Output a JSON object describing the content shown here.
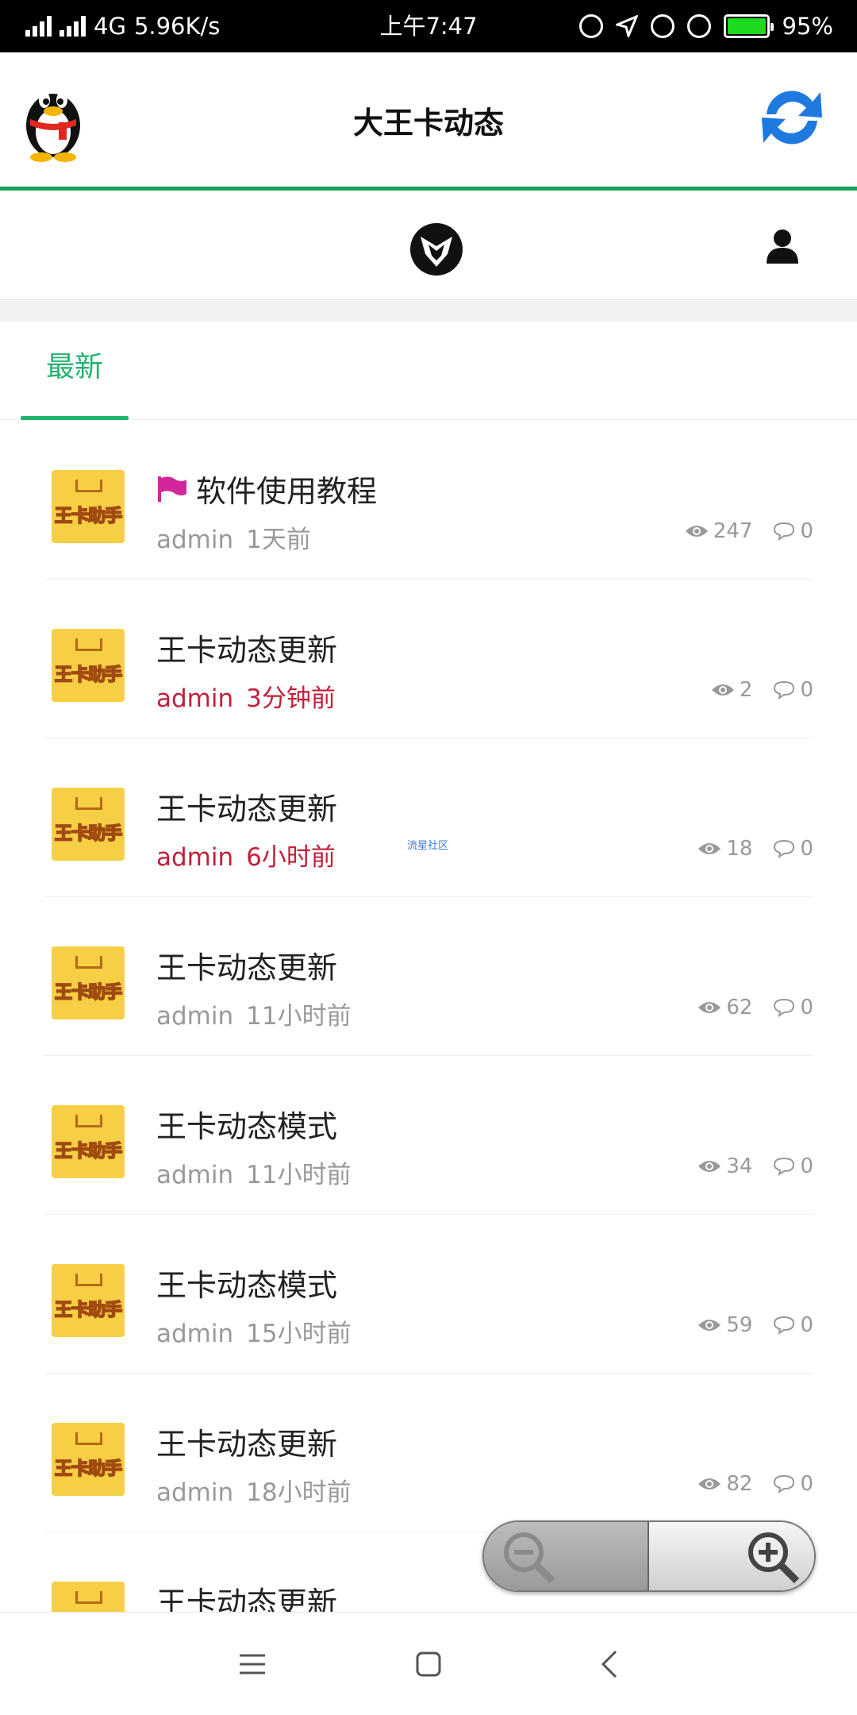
{
  "status_bar": {
    "network": "4G",
    "speed": "5.96K/s",
    "time": "上午7:47",
    "battery": "95%"
  },
  "header": {
    "title": "大王卡动态"
  },
  "tabs": [
    {
      "label": "最新"
    }
  ],
  "posts": [
    {
      "title": "软件使用教程",
      "pinned": true,
      "author": "admin",
      "time": "1天前",
      "views": "247",
      "comments": "0",
      "highlight": false
    },
    {
      "title": "王卡动态更新",
      "pinned": false,
      "author": "admin",
      "time": "3分钟前",
      "views": "2",
      "comments": "0",
      "highlight": true
    },
    {
      "title": "王卡动态更新",
      "pinned": false,
      "author": "admin",
      "time": "6小时前",
      "views": "18",
      "comments": "0",
      "highlight": true
    },
    {
      "title": "王卡动态更新",
      "pinned": false,
      "author": "admin",
      "time": "11小时前",
      "views": "62",
      "comments": "0",
      "highlight": false
    },
    {
      "title": "王卡动态模式",
      "pinned": false,
      "author": "admin",
      "time": "11小时前",
      "views": "34",
      "comments": "0",
      "highlight": false
    },
    {
      "title": "王卡动态模式",
      "pinned": false,
      "author": "admin",
      "time": "15小时前",
      "views": "59",
      "comments": "0",
      "highlight": false
    },
    {
      "title": "王卡动态更新",
      "pinned": false,
      "author": "admin",
      "time": "18小时前",
      "views": "82",
      "comments": "0",
      "highlight": false
    },
    {
      "title": "王卡动态更新",
      "pinned": false,
      "author": "",
      "time": "",
      "views": "",
      "comments": "",
      "highlight": false
    }
  ],
  "avatar_text": "王卡助手",
  "watermark": "流星社区",
  "colors": {
    "accent": "#23b26d",
    "header_border": "#1a9e5c",
    "highlight_meta": "#c0203a",
    "flag": "#d3269b",
    "refresh": "#1f7ae0"
  }
}
